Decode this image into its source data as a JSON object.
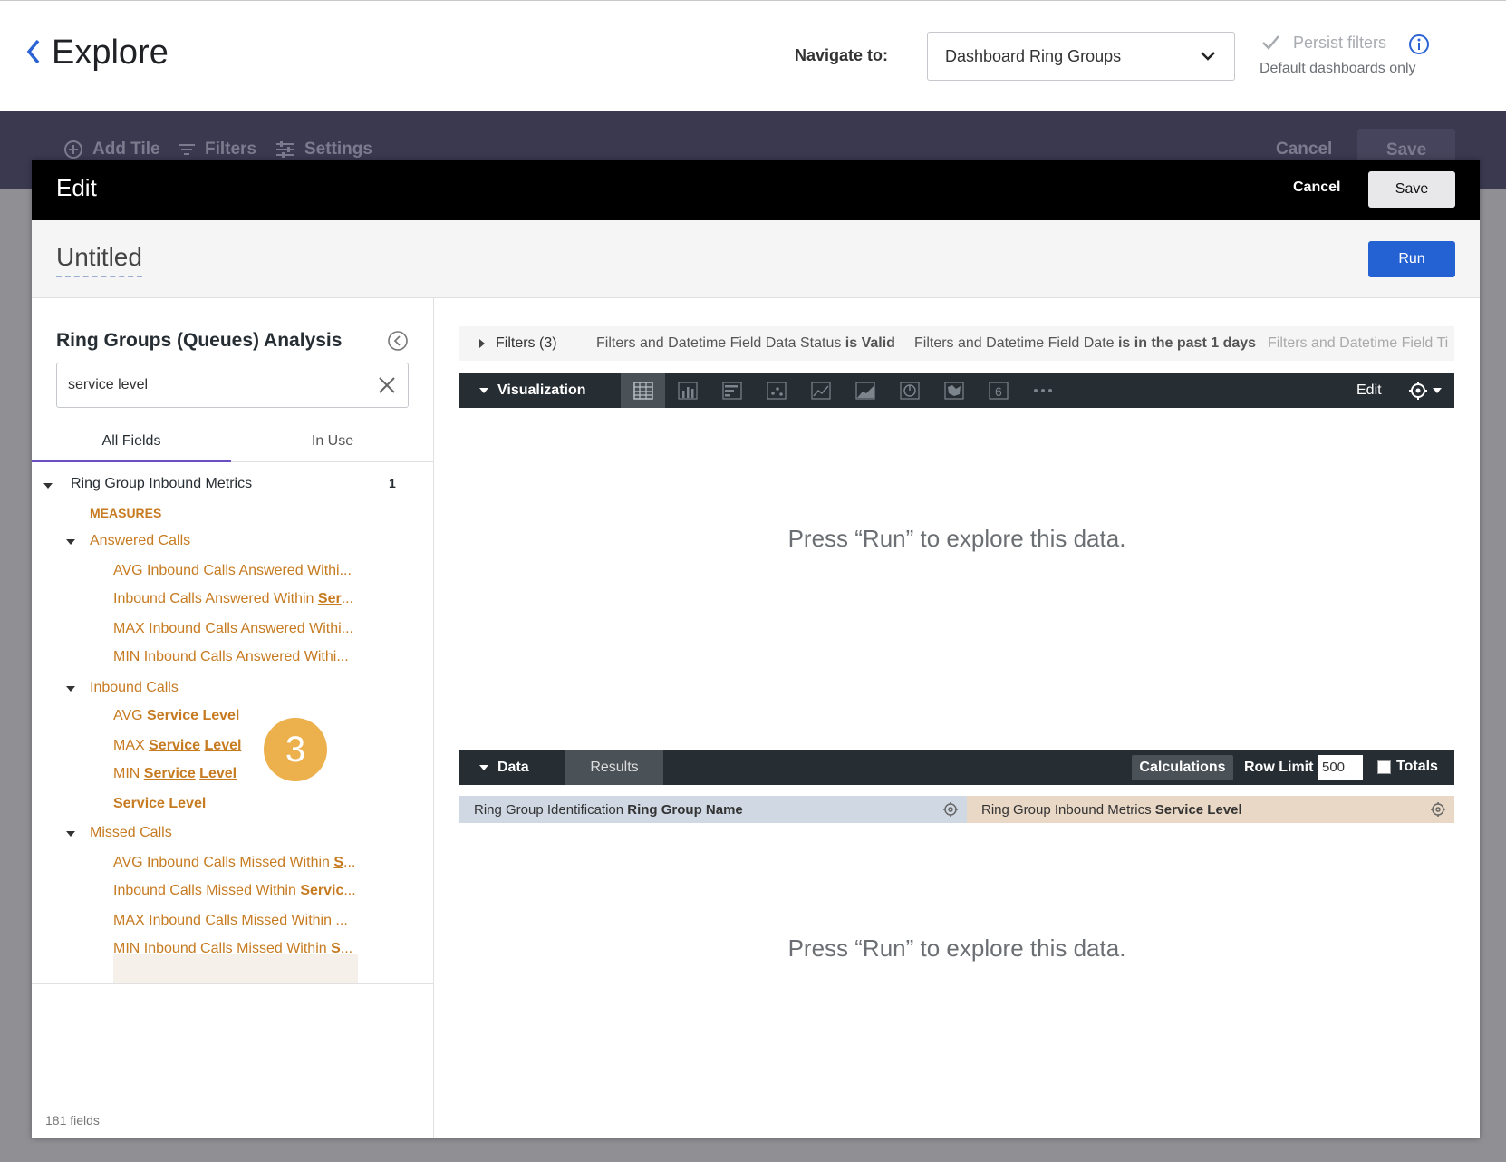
{
  "header": {
    "title": "Explore",
    "navigate_label": "Navigate to:",
    "navigate_value": "Dashboard Ring Groups",
    "persist_label": "Persist filters",
    "persist_sub": "Default dashboards only"
  },
  "dashboard_toolbar": {
    "add_tile": "Add Tile",
    "filters": "Filters",
    "settings": "Settings",
    "cancel": "Cancel",
    "save": "Save"
  },
  "modal": {
    "title": "Edit",
    "cancel": "Cancel",
    "save": "Save",
    "query_title": "Untitled",
    "run": "Run"
  },
  "left_panel": {
    "explore_title": "Ring Groups (Queues) Analysis",
    "search_value": "service level",
    "tabs": [
      "All Fields",
      "In Use"
    ],
    "view_name": "Ring Group Inbound Metrics",
    "view_count": "1",
    "measures_label": "MEASURES",
    "groups": [
      {
        "name": "Answered Calls",
        "fields": [
          {
            "pre": "AVG Inbound Calls Answered Withi...",
            "u": "",
            "post": ""
          },
          {
            "pre": "Inbound Calls Answered Within ",
            "u": "Ser",
            "post": "..."
          },
          {
            "pre": "MAX Inbound Calls Answered Withi...",
            "u": "",
            "post": ""
          },
          {
            "pre": "MIN Inbound Calls Answered Withi...",
            "u": "",
            "post": ""
          }
        ]
      },
      {
        "name": "Inbound Calls",
        "fields": [
          {
            "pre": "AVG ",
            "u": "Service",
            "u2": "Level"
          },
          {
            "pre": "MAX ",
            "u": "Service",
            "u2": "Level"
          },
          {
            "pre": "MIN ",
            "u": "Service",
            "u2": "Level"
          },
          {
            "pre": "",
            "u": "Service",
            "u2": "Level"
          }
        ]
      },
      {
        "name": "Missed Calls",
        "fields": [
          {
            "pre": "AVG Inbound Calls Missed Within ",
            "u": "S",
            "post": "..."
          },
          {
            "pre": "Inbound Calls Missed Within ",
            "u": "Servic",
            "post": "..."
          },
          {
            "pre": "MAX Inbound Calls Missed Within ...",
            "u": "",
            "post": ""
          },
          {
            "pre": "MIN Inbound Calls Missed Within ",
            "u": "S",
            "post": "..."
          }
        ]
      }
    ],
    "field_count": "181 fields",
    "step_badge": "3"
  },
  "right_panel": {
    "filters_label": "Filters (3)",
    "filter_chips": [
      {
        "pre": "Filters and Datetime Field Data Status ",
        "bold": "is Valid"
      },
      {
        "pre": "Filters and Datetime Field Date ",
        "bold": "is in the past 1 days"
      },
      {
        "pre": "Filters and Datetime Field Ti",
        "bold": ""
      }
    ],
    "viz_label": "Visualization",
    "viz_edit": "Edit",
    "viz_placeholder": "Press “Run” to explore this data.",
    "data_label": "Data",
    "results_tab": "Results",
    "calculations": "Calculations",
    "row_limit_label": "Row Limit",
    "row_limit_value": "500",
    "totals_label": "Totals",
    "columns": [
      {
        "view": "Ring Group Identification ",
        "field": "Ring Group Name"
      },
      {
        "view": "Ring Group Inbound Metrics ",
        "field": "Service Level"
      }
    ],
    "data_placeholder": "Press “Run” to explore this data."
  },
  "colors": {
    "accent": "#2461d3",
    "measure": "#c77b21",
    "tab_underline": "#6a4fc4",
    "badge": "#ecb04d"
  }
}
